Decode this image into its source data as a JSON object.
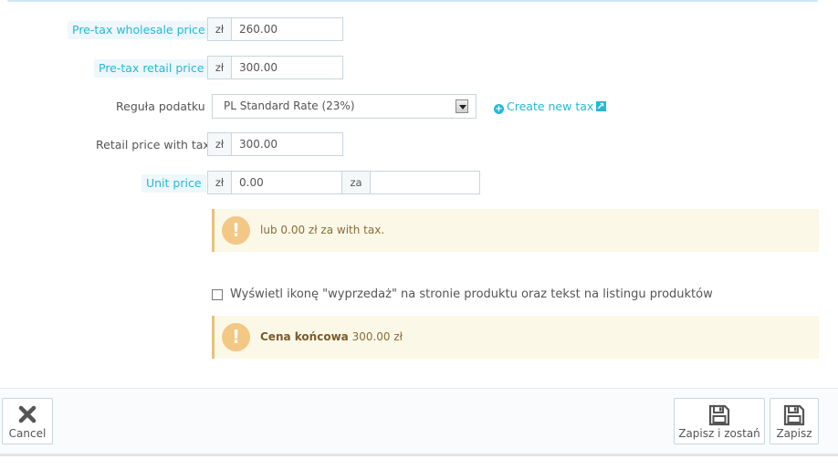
{
  "form": {
    "wholesale": {
      "label": "Pre-tax wholesale price",
      "currency": "zł",
      "value": "260.00"
    },
    "retail": {
      "label": "Pre-tax retail price",
      "currency": "zł",
      "value": "300.00"
    },
    "tax_rule": {
      "label": "Reguła podatku",
      "selected": "PL Standard Rate (23%)",
      "create_link": "Create new tax"
    },
    "retail_with_tax": {
      "label": "Retail price with tax",
      "currency": "zł",
      "value": "300.00"
    },
    "unit_price": {
      "label": "Unit price",
      "currency": "zł",
      "value": "0.00",
      "per_label": "za",
      "per_value": ""
    }
  },
  "alerts": {
    "unit_info": "lub 0.00 zł za with tax.",
    "final_price_label": "Cena końcowa",
    "final_price_value": "300.00 zł",
    "icon": "exclamation"
  },
  "sale": {
    "checked": false,
    "label": "Wyświetl ikonę \"wyprzedaż\" na stronie produktu oraz tekst na listingu produktów"
  },
  "footer": {
    "cancel_label": "Cancel",
    "save_stay_label": "Zapisz i zostań",
    "save_label": "Zapisz"
  },
  "colors": {
    "accent": "#25b9d7",
    "warning_bg": "#fcf8e8",
    "warning_icon": "#f3c784"
  }
}
